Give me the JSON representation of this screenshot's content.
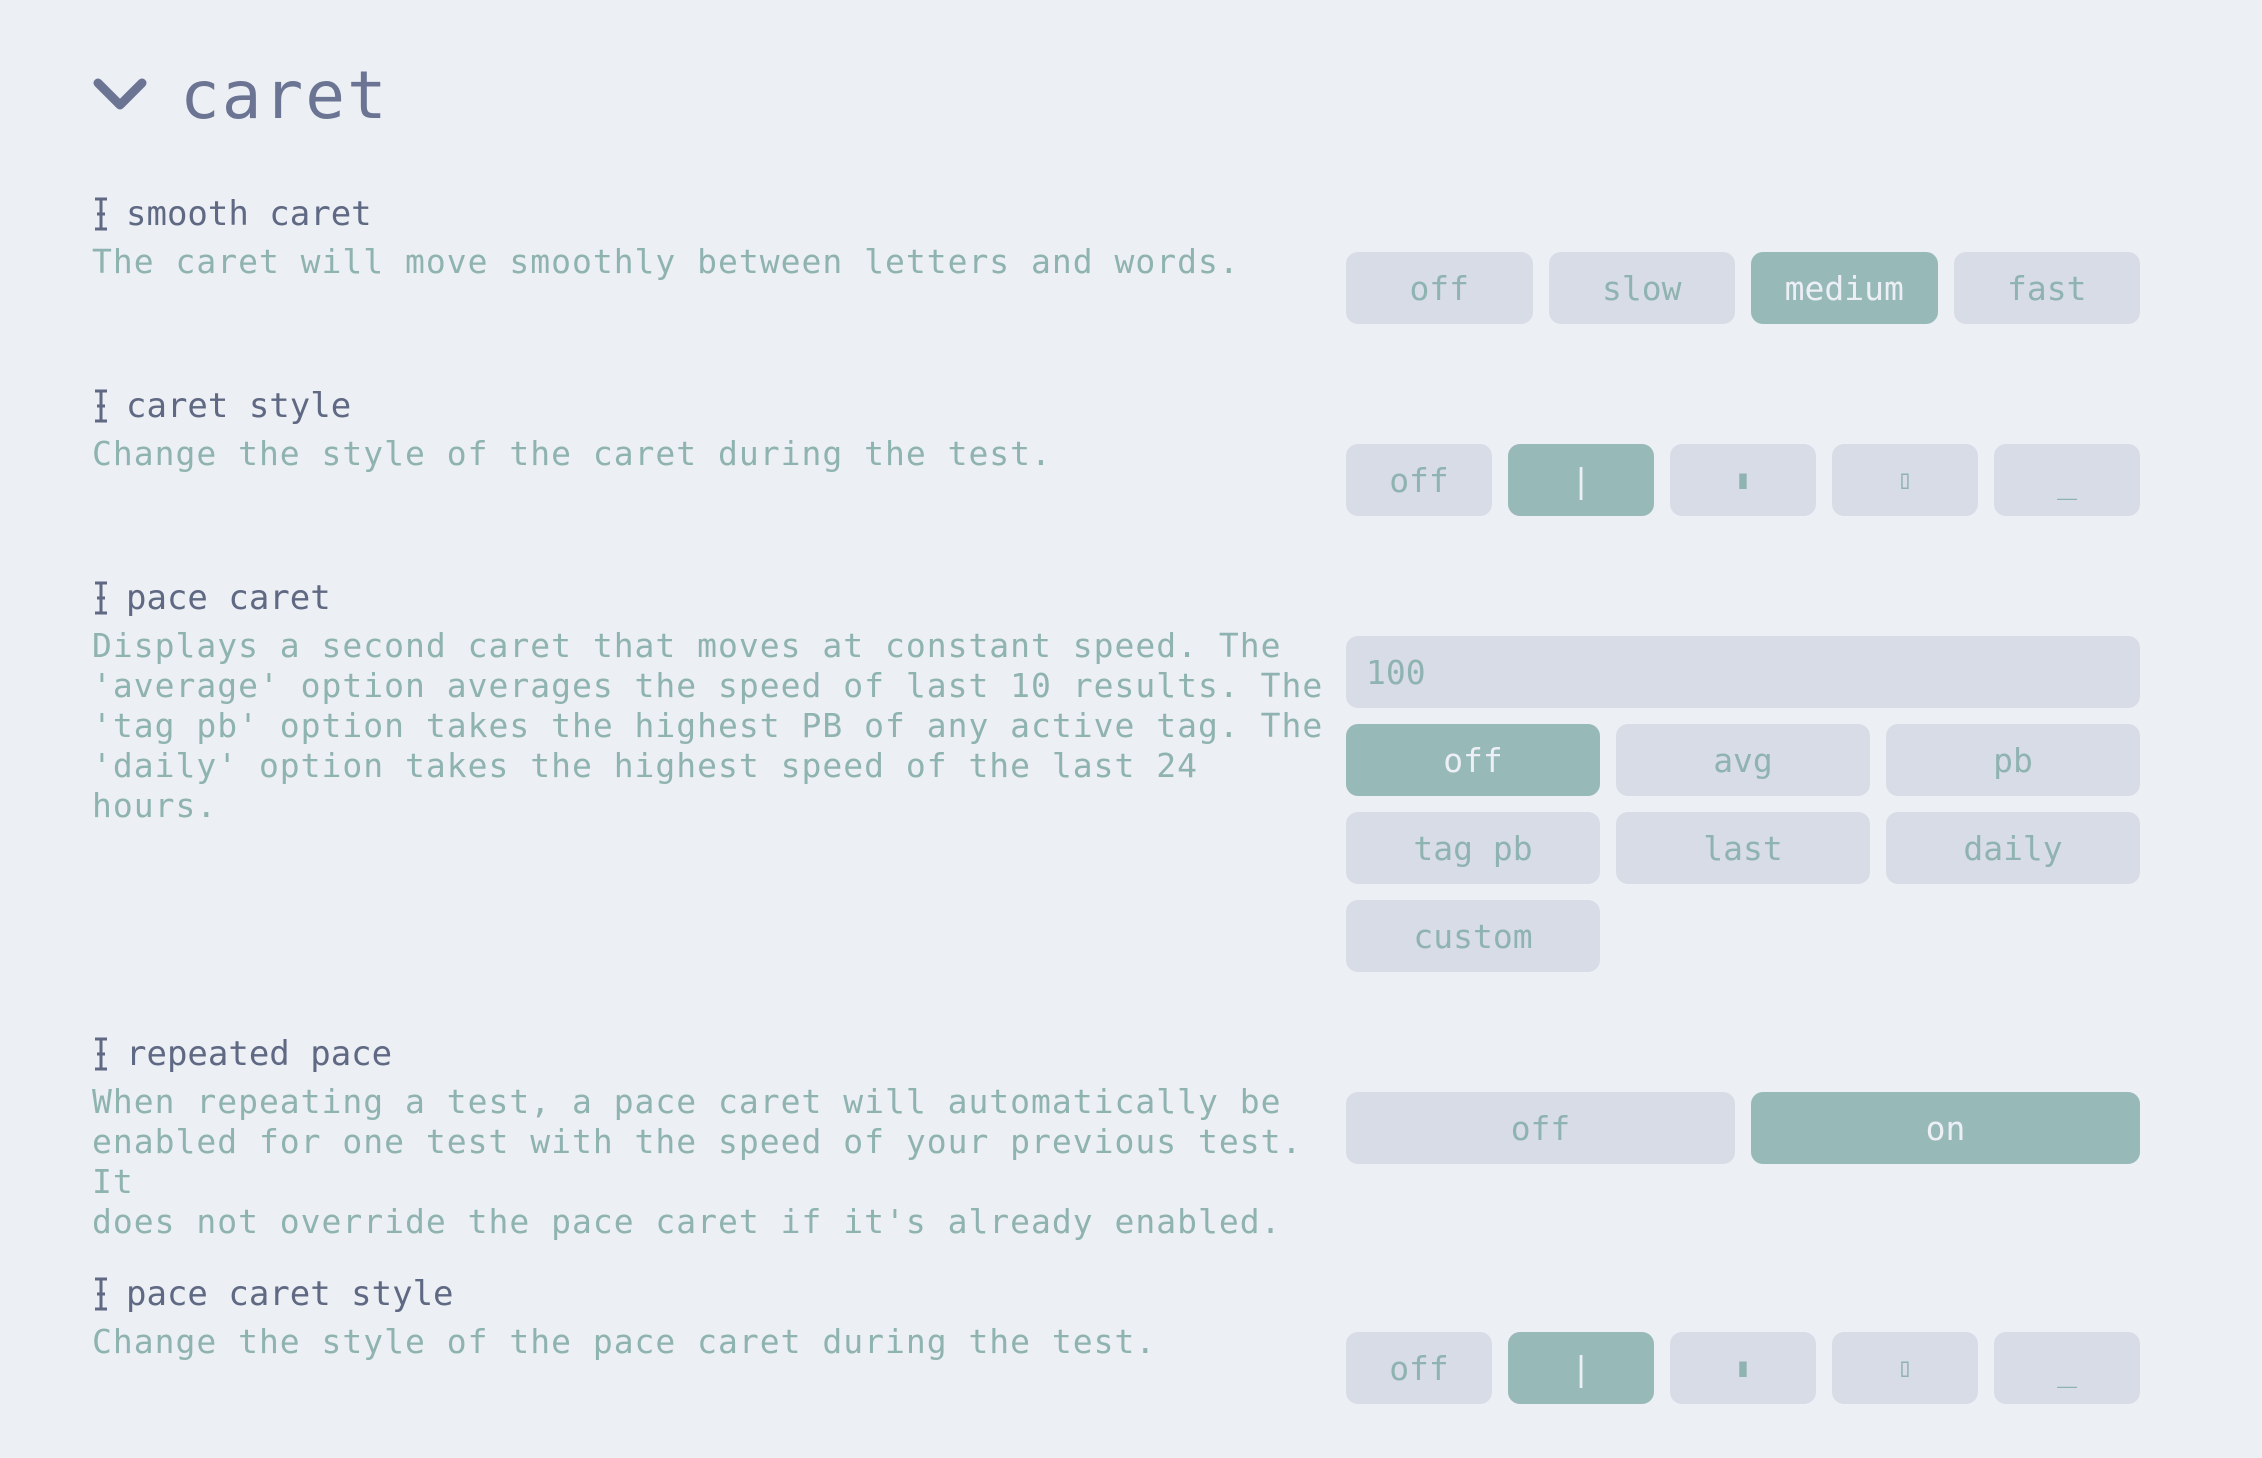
{
  "section": {
    "title": "caret"
  },
  "settings": {
    "smooth_caret": {
      "title": "smooth caret",
      "description": "The caret will move smoothly between letters and words.",
      "options": [
        "off",
        "slow",
        "medium",
        "fast"
      ],
      "selected": "medium"
    },
    "caret_style": {
      "title": "caret style",
      "description": "Change the style of the caret during the test.",
      "options": [
        "off",
        "|",
        "▮",
        "▯",
        "_"
      ],
      "selected": "|"
    },
    "pace_caret": {
      "title": "pace caret",
      "description": "Displays a second caret that moves at constant speed. The\n'average' option averages the speed of last 10 results. The\n'tag pb' option takes the highest PB of any active tag. The\n'daily' option takes the highest speed of the last 24 hours.",
      "input_value": "100",
      "options": [
        "off",
        "avg",
        "pb",
        "tag pb",
        "last",
        "daily",
        "custom"
      ],
      "selected": "off"
    },
    "repeated_pace": {
      "title": "repeated pace",
      "description": "When repeating a test, a pace caret will automatically be\nenabled for one test with the speed of your previous test. It\ndoes not override the pace caret if it's already enabled.",
      "options": [
        "off",
        "on"
      ],
      "selected": "on"
    },
    "pace_caret_style": {
      "title": "pace caret style",
      "description": "Change the style of the pace caret during the test.",
      "options": [
        "off",
        "|",
        "▮",
        "▯",
        "_"
      ],
      "selected": "|"
    }
  },
  "colors": {
    "background": "#eceff4",
    "button": "#d8dce6",
    "accent": "#97b9b8",
    "text_main": "#5f6983",
    "text_sub": "#8fb3b0"
  },
  "icons": {
    "section": "chevron-down-icon",
    "setting": "i-beam-cursor-icon"
  }
}
